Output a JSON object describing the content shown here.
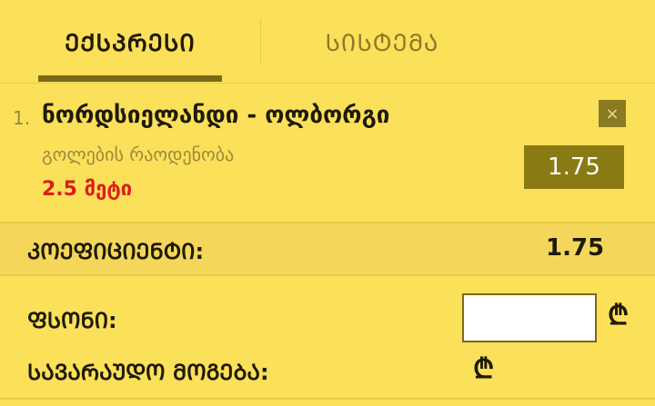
{
  "tabs": [
    {
      "label": "ᲔᲥᲡᲞᲠᲔᲡᲘ",
      "active": true
    },
    {
      "label": "ᲡᲘᲡᲢᲔᲛᲐ",
      "active": false
    }
  ],
  "bet": {
    "index": "1.",
    "match": "ნორდსიელანდი - ოლბორგი",
    "market": "გოლების რაოდენობა",
    "selection": "2.5 მეტი",
    "odds": "1.75",
    "remove_icon": "×"
  },
  "summary": {
    "total_odds_label": "ᲙᲝᲔᲤᲘᲪᲘᲔᲜᲢᲘ:",
    "total_odds_value": "1.75",
    "stake_label": "ᲤᲡᲝᲜᲘ:",
    "stake_value": "",
    "currency_symbol": "₾",
    "potential_win_label": "ᲡᲐᲕᲐᲠᲐᲣᲓᲝ ᲛᲝᲒᲔᲑᲐ:"
  },
  "colors": {
    "background": "#fbe05a",
    "accent_dark": "#8a7a14",
    "selection_red": "#d81e1e",
    "muted_text": "#9a8a3a"
  }
}
